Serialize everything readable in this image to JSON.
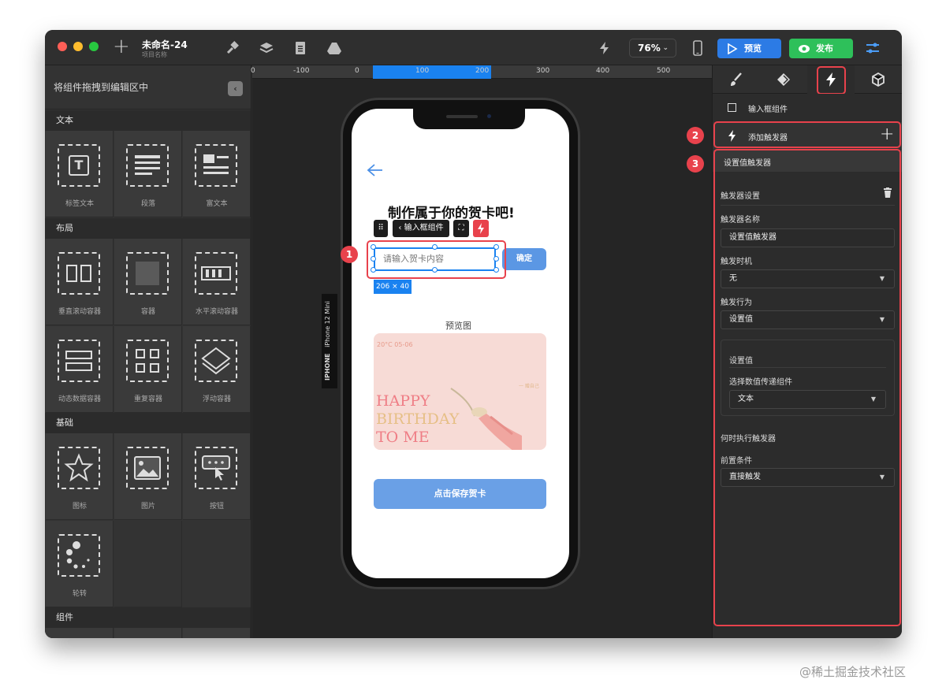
{
  "window": {
    "project_title": "未命名-24",
    "project_subtitle": "项目名称",
    "zoom": "76%",
    "preview_label": "预览",
    "publish_label": "发布"
  },
  "left_panel": {
    "header": "将组件拖拽到编辑区中",
    "sections": {
      "text": "文本",
      "layout": "布局",
      "basic": "基础",
      "components": "组件"
    },
    "items": {
      "label_text": "标签文本",
      "paragraph": "段落",
      "rich_text": "富文本",
      "vertical_scroll": "垂直滚动容器",
      "container": "容器",
      "horizontal_scroll": "水平滚动容器",
      "dynamic_data": "动态数据容器",
      "repeat": "重复容器",
      "floating": "浮动容器",
      "icon": "图标",
      "image": "图片",
      "button": "按钮",
      "carousel": "轮转"
    }
  },
  "ruler": {
    "ticks": [
      "0",
      "-100",
      "0",
      "100",
      "200",
      "300",
      "400",
      "500"
    ]
  },
  "device": {
    "model": "iPhone 12 Mini",
    "type": "IPHONE"
  },
  "screen": {
    "title": "制作属于你的贺卡吧!",
    "component_tag": "输入框组件",
    "input_placeholder": "请输入贺卡内容",
    "confirm_label": "确定",
    "size_badge": "206 × 40",
    "preview_title": "预览图",
    "card": {
      "weather": "20°C 05-06",
      "line1": "HAPPY",
      "line2": "BIRTHDAY",
      "line3": "TO ME",
      "side_text": "一 赠自己"
    },
    "save_label": "点击保存贺卡"
  },
  "badges": {
    "one": "1",
    "two": "2",
    "three": "3"
  },
  "right_panel": {
    "component_name": "输入框组件",
    "add_trigger": "添加触发器",
    "trigger_title": "设置值触发器",
    "trigger_settings": "触发器设置",
    "trigger_name_label": "触发器名称",
    "trigger_name_value": "设置值触发器",
    "trigger_timing_label": "触发时机",
    "trigger_timing_value": "无",
    "trigger_action_label": "触发行为",
    "trigger_action_value": "设置值",
    "set_value_title": "设置值",
    "select_component_label": "选择数值传递组件",
    "select_component_value": "文本",
    "when_execute": "何时执行触发器",
    "precondition_label": "前置条件",
    "precondition_value": "直接触发"
  },
  "watermark": "@稀土掘金技术社区"
}
